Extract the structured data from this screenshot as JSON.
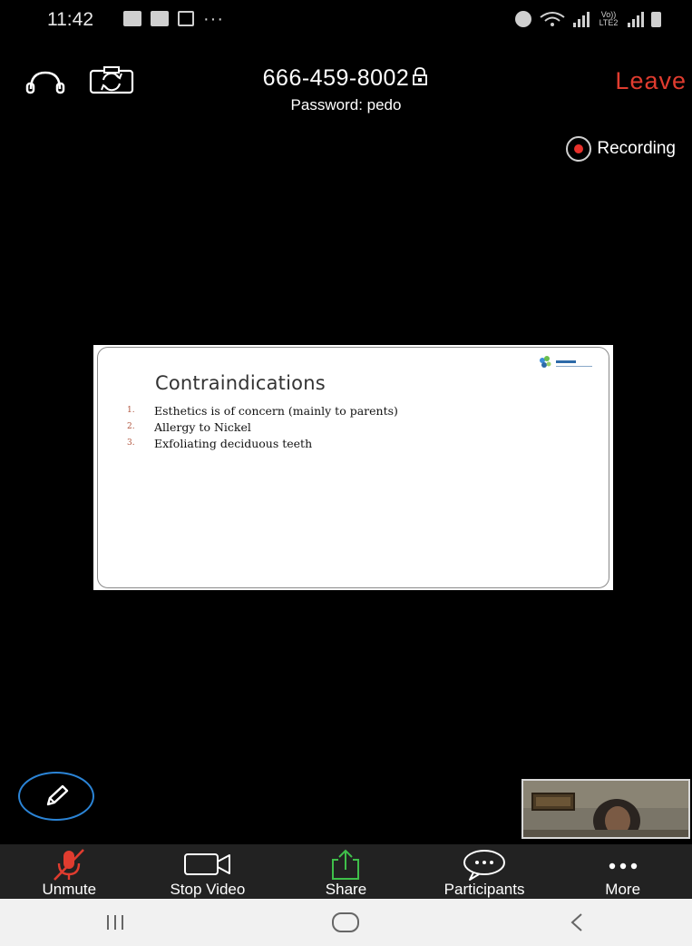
{
  "status_bar": {
    "time": "11:42",
    "overflow_dots": "···",
    "network_label": "Vo)) LTE2"
  },
  "meeting": {
    "id": "666-459-8002",
    "password": "Password: pedo",
    "leave_label": "Leave",
    "recording_label": "Recording"
  },
  "slide": {
    "title": "Contraindications",
    "items": [
      {
        "num": "1.",
        "text": "Esthetics  is of concern (mainly to parents)"
      },
      {
        "num": "2.",
        "text": "Allergy to Nickel"
      },
      {
        "num": "3.",
        "text": "Exfoliating deciduous teeth"
      }
    ]
  },
  "toolbar": {
    "unmute_label": "Unmute",
    "stop_video_label": "Stop Video",
    "share_label": "Share",
    "participants_label": "Participants",
    "more_label": "More"
  },
  "icons": {
    "audio": "headphones-icon",
    "camera_switch": "camera-switch-icon",
    "lock": "lock-icon",
    "annotate": "pencil-icon",
    "mic_muted": "microphone-off-icon",
    "video": "video-camera-icon",
    "share": "share-upload-icon",
    "participants": "chat-bubble-icon",
    "more": "ellipsis-icon",
    "nav_recents": "recents-icon",
    "nav_home": "home-icon",
    "nav_back": "back-icon"
  },
  "colors": {
    "leave": "#e03c2f",
    "recording_dot": "#e8302a",
    "muted_mic": "#e03c2f",
    "share_green": "#3fbf4a",
    "annotate_ring": "#2b84d6",
    "toolbar_bg": "#222222"
  }
}
